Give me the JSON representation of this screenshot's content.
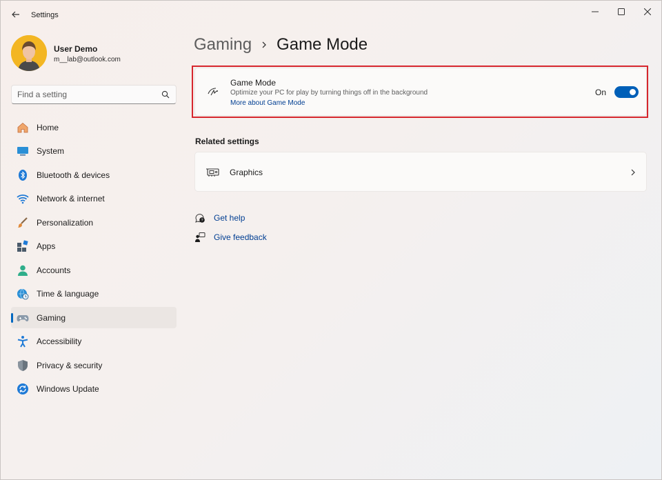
{
  "window": {
    "title": "Settings"
  },
  "profile": {
    "name": "User Demo",
    "email": "m__lab@outlook.com"
  },
  "search": {
    "placeholder": "Find a setting"
  },
  "sidebar": {
    "items": [
      {
        "label": "Home",
        "icon": "home-icon"
      },
      {
        "label": "System",
        "icon": "system-icon"
      },
      {
        "label": "Bluetooth & devices",
        "icon": "bluetooth-icon"
      },
      {
        "label": "Network & internet",
        "icon": "wifi-icon"
      },
      {
        "label": "Personalization",
        "icon": "brush-icon"
      },
      {
        "label": "Apps",
        "icon": "apps-icon"
      },
      {
        "label": "Accounts",
        "icon": "person-icon"
      },
      {
        "label": "Time & language",
        "icon": "globe-clock-icon"
      },
      {
        "label": "Gaming",
        "icon": "gamepad-icon",
        "selected": true
      },
      {
        "label": "Accessibility",
        "icon": "accessibility-icon"
      },
      {
        "label": "Privacy & security",
        "icon": "shield-icon"
      },
      {
        "label": "Windows Update",
        "icon": "update-icon"
      }
    ]
  },
  "breadcrumb": {
    "parent": "Gaming",
    "current": "Game Mode"
  },
  "game_mode": {
    "title": "Game Mode",
    "description": "Optimize your PC for play by turning things off in the background",
    "link": "More about Game Mode",
    "state_label": "On",
    "enabled": true
  },
  "related": {
    "heading": "Related settings",
    "items": [
      {
        "label": "Graphics",
        "icon": "graphics-card-icon"
      }
    ]
  },
  "help": {
    "get_help": "Get help",
    "give_feedback": "Give feedback"
  },
  "colors": {
    "accent": "#005fb8",
    "link": "#003e92",
    "highlight_border": "#d6262d",
    "avatar_bg": "#f3b623"
  }
}
